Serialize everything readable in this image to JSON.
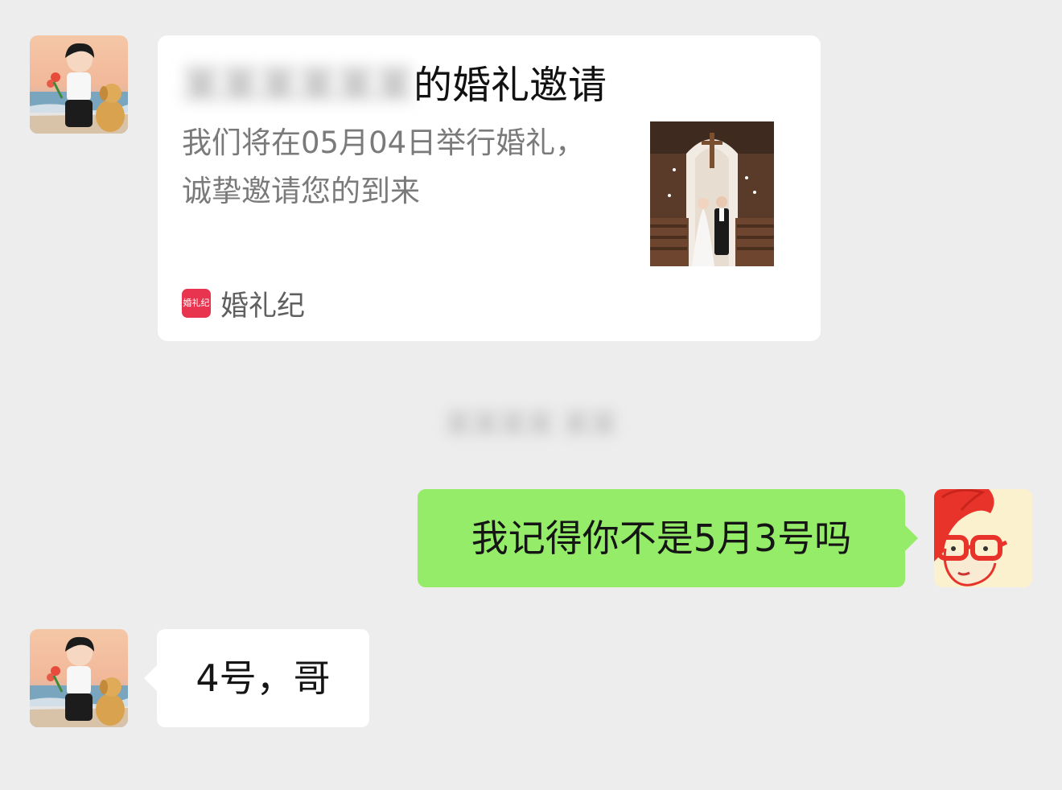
{
  "messages": {
    "invite_card": {
      "title_hidden": "某某某某某某",
      "title_visible": "的婚礼邀请",
      "description_line1": "我们将在05月04日举行婚礼，",
      "description_line2": "诚挚邀请您的到来",
      "source_logo_text": "婚礼纪",
      "source_name": "婚礼纪",
      "thumbnail_icon": "wedding-photo"
    },
    "timestamp": "某某某某 某某",
    "outgoing_text": "我记得你不是5月3号吗",
    "reply_text": "4号，哥"
  },
  "colors": {
    "background": "#ededed",
    "outgoing_bubble": "#95ec69",
    "incoming_bubble": "#ffffff",
    "brand_logo": "#e8344e"
  }
}
